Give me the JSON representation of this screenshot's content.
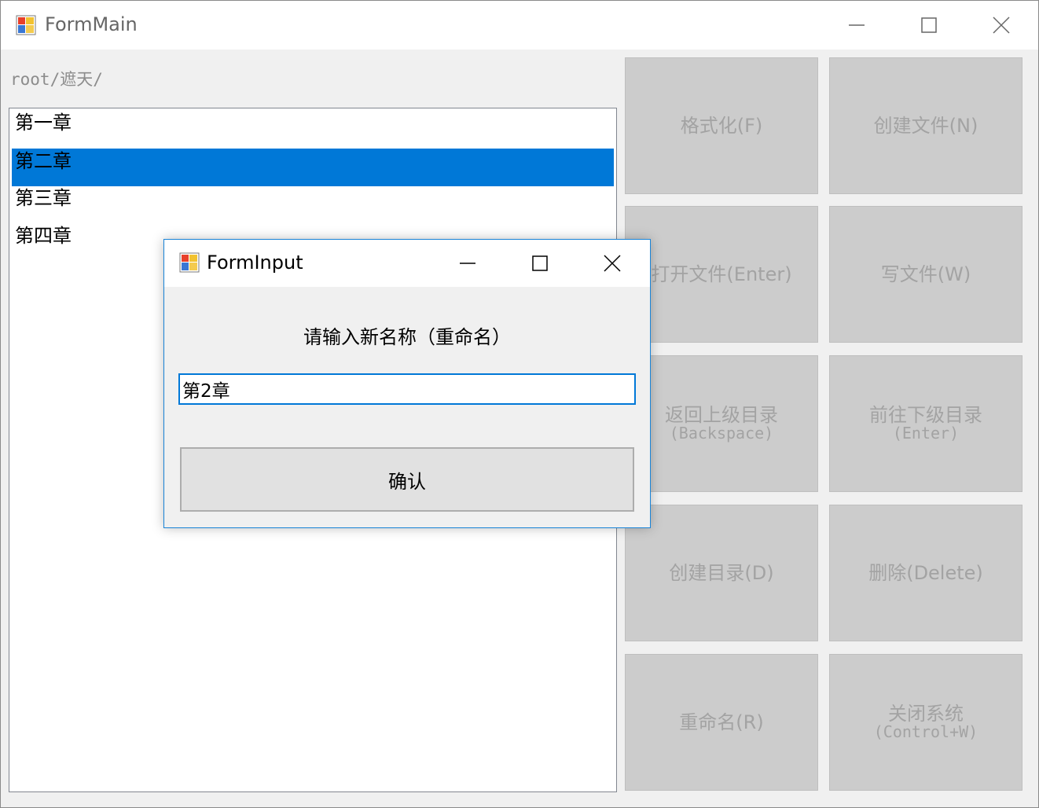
{
  "main_window": {
    "title": "FormMain",
    "path": "root/遮天/",
    "list_items": [
      "第一章",
      "第二章",
      "第三章",
      "第四章"
    ],
    "selected_index": 1,
    "buttons": [
      {
        "label": "格式化(F)",
        "sub": ""
      },
      {
        "label": "创建文件(N)",
        "sub": ""
      },
      {
        "label": "打开文件(Enter)",
        "sub": ""
      },
      {
        "label": "写文件(W)",
        "sub": ""
      },
      {
        "label": "返回上级目录",
        "sub": "(Backspace)"
      },
      {
        "label": "前往下级目录",
        "sub": "(Enter)"
      },
      {
        "label": "创建目录(D)",
        "sub": ""
      },
      {
        "label": "删除(Delete)",
        "sub": ""
      },
      {
        "label": "重命名(R)",
        "sub": ""
      },
      {
        "label": "关闭系统",
        "sub": "(Control+W)"
      }
    ]
  },
  "dialog": {
    "title": "FormInput",
    "prompt": "请输入新名称（重命名）",
    "input_value": "第2章",
    "confirm_label": "确认"
  },
  "colors": {
    "selection": "#0078d7",
    "dialog_border": "#1883d7",
    "disabled_button": "#cccccc",
    "disabled_text": "#a3a3a3"
  },
  "icons": {
    "app": "app-window-icon",
    "minimize": "minimize-icon",
    "maximize": "maximize-icon",
    "close": "close-icon"
  }
}
